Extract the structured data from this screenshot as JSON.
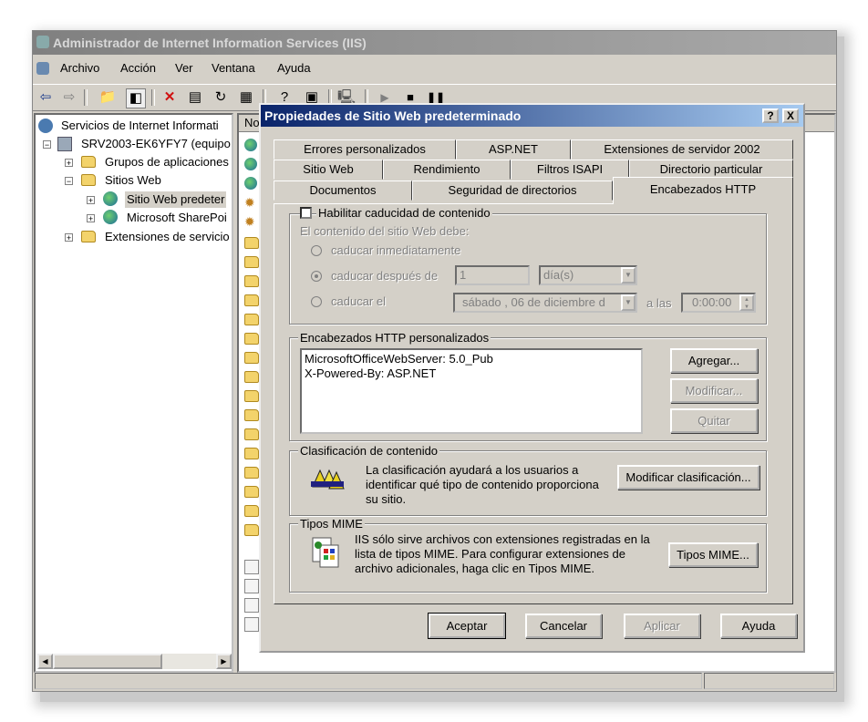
{
  "window": {
    "title": "Administrador de Internet Information Services (IIS)",
    "menu": [
      "Archivo",
      "Acción",
      "Ver",
      "Ventana",
      "Ayuda"
    ]
  },
  "tree": {
    "items": [
      {
        "label": "Servicios de Internet Informati",
        "icon": "iis-icon"
      },
      {
        "label": "SRV2003-EK6YFY7 (equipo",
        "icon": "server-icon"
      },
      {
        "label": "Grupos de aplicaciones",
        "icon": "folder-icon"
      },
      {
        "label": "Sitios Web",
        "icon": "folder-icon"
      },
      {
        "label": "Sitio Web predeter",
        "icon": "globe-icon"
      },
      {
        "label": "Microsoft SharePoi",
        "icon": "globe-icon"
      },
      {
        "label": "Extensiones de servicio",
        "icon": "folder-icon"
      }
    ]
  },
  "list": {
    "column_header": "No"
  },
  "dialog": {
    "title": "Propiedades de Sitio Web predeterminado",
    "help_btn": "?",
    "close_btn": "X",
    "tabs_row1": [
      "Errores personalizados",
      "ASP.NET",
      "Extensiones de servidor 2002"
    ],
    "tabs_row2": [
      "Sitio Web",
      "Rendimiento",
      "Filtros ISAPI",
      "Directorio particular"
    ],
    "tabs_row3": [
      "Documentos",
      "Seguridad de directorios",
      "Encabezados HTTP"
    ],
    "expiration": {
      "checkbox_label": "Habilitar caducidad de contenido",
      "caption": "El contenido del sitio Web debe:",
      "opt_immediately": "caducar inmediatamente",
      "opt_after": "caducar después de",
      "after_value": "1",
      "after_unit": "día(s)",
      "opt_on": "caducar el",
      "date_value": "sábado , 06 de diciembre d",
      "at_label": "a las",
      "time_value": "0:00:00"
    },
    "custom_headers": {
      "label": "Encabezados HTTP personalizados",
      "items": [
        "MicrosoftOfficeWebServer: 5.0_Pub",
        "X-Powered-By: ASP.NET"
      ],
      "add": "Agregar...",
      "edit": "Modificar...",
      "remove": "Quitar"
    },
    "rating": {
      "label": "Clasificación de contenido",
      "text": "La clasificación ayudará a los usuarios a identificar qué tipo de contenido proporciona su sitio.",
      "button": "Modificar clasificación..."
    },
    "mime": {
      "label": "Tipos MIME",
      "text": "IIS sólo sirve archivos con extensiones registradas en la lista de tipos MIME. Para configurar extensiones de archivo adicionales, haga clic en Tipos MIME.",
      "button": "Tipos MIME..."
    },
    "buttons": {
      "ok": "Aceptar",
      "cancel": "Cancelar",
      "apply": "Aplicar",
      "help": "Ayuda"
    }
  }
}
